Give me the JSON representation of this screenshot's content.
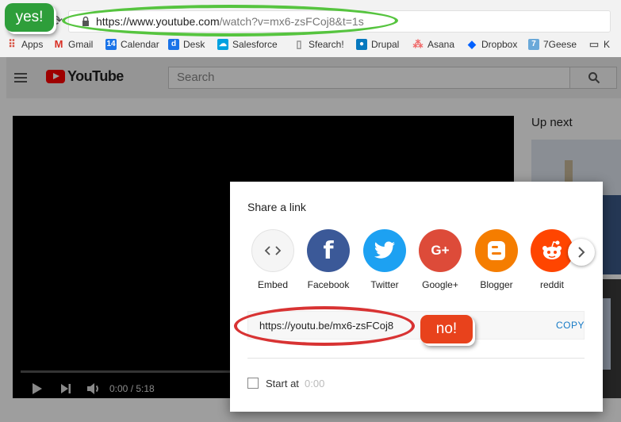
{
  "browser": {
    "url_main": "https://www.youtube.com",
    "url_rest": "/watch?v=mx6-zsFCoj8&t=1s",
    "bookmarks": [
      {
        "label": "Apps",
        "icon": "apps-grid-icon",
        "color": "#d64a3a"
      },
      {
        "label": "Gmail",
        "icon": "gmail-icon",
        "color": "#d93025"
      },
      {
        "label": "Calendar",
        "icon": "calendar-icon",
        "color": "#1a73e8"
      },
      {
        "label": "Desk",
        "icon": "desk-icon",
        "color": "#1a73e8"
      },
      {
        "label": "Salesforce",
        "icon": "salesforce-icon",
        "color": "#00a1e0"
      },
      {
        "label": "Sfearch!",
        "icon": "page-icon",
        "color": "#888888"
      },
      {
        "label": "Drupal",
        "icon": "drupal-icon",
        "color": "#0678be"
      },
      {
        "label": "Asana",
        "icon": "asana-icon",
        "color": "#f06a6a"
      },
      {
        "label": "Dropbox",
        "icon": "dropbox-icon",
        "color": "#0061ff"
      },
      {
        "label": "7Geese",
        "icon": "7geese-icon",
        "color": "#6aa9d9"
      },
      {
        "label": "K",
        "icon": "folder-icon",
        "color": "#666666"
      }
    ]
  },
  "annotations": {
    "yes": "yes!",
    "no": "no!"
  },
  "youtube": {
    "logo_text": "YouTube",
    "search_placeholder": "Search",
    "time": "0:00 / 5:18",
    "up_next": "Up next"
  },
  "share": {
    "title": "Share a link",
    "items": [
      {
        "label": "Embed",
        "icon": "embed-code-icon",
        "color": "#f2f2f2"
      },
      {
        "label": "Facebook",
        "icon": "facebook-icon",
        "color": "#3b5998"
      },
      {
        "label": "Twitter",
        "icon": "twitter-icon",
        "color": "#1da1f2"
      },
      {
        "label": "Google+",
        "icon": "google-plus-icon",
        "color": "#dd4b39"
      },
      {
        "label": "Blogger",
        "icon": "blogger-icon",
        "color": "#f57d00"
      },
      {
        "label": "reddit",
        "icon": "reddit-icon",
        "color": "#ff4500"
      }
    ],
    "link": "https://youtu.be/mx6-zsFCoj8",
    "copy_label": "COPY",
    "start_label": "Start at",
    "start_time": "0:00"
  }
}
